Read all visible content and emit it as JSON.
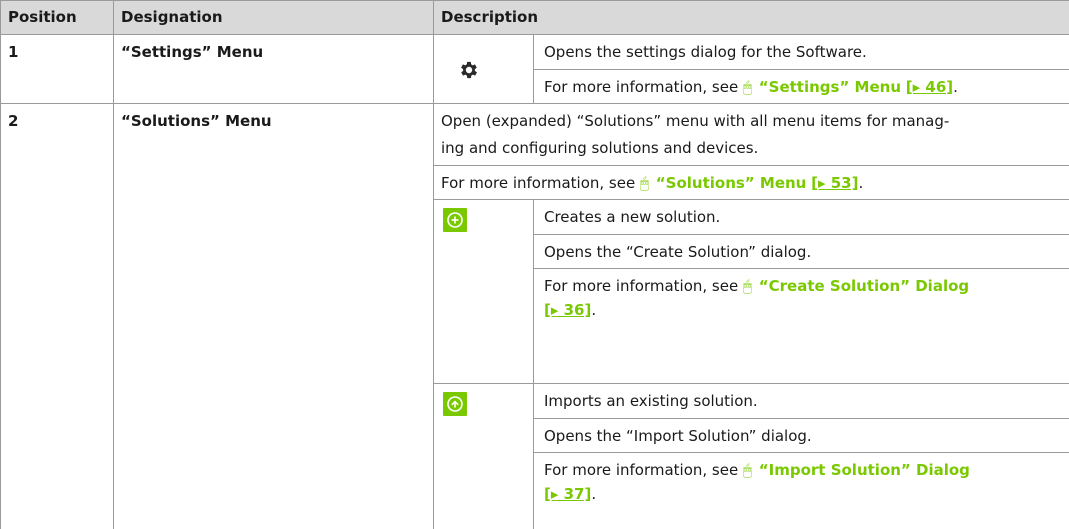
{
  "header": {
    "position": "Position",
    "designation": "Designation",
    "description": "Description"
  },
  "rows": [
    {
      "position": "1",
      "designation": "“Settings” Menu",
      "icon": "gear-icon",
      "text": "Opens the settings dialog for the Software.",
      "more_prefix": "For more information, see",
      "link": "“Settings” Menu",
      "link_ref": "[▸ 46]"
    },
    {
      "position": "2",
      "designation": "“Solutions” Menu",
      "text_line1": "Open (expanded) “Solutions” menu with all menu items for manag-",
      "text_line2": "ing and configuring solutions and devices.",
      "more_prefix": "For more information, see",
      "link": "“Solutions” Menu",
      "link_ref": "[▸ 53]",
      "subitems": [
        {
          "icon": "add-circle-icon",
          "line1": "Creates a new solution.",
          "line2": "Opens the “Create Solution” dialog.",
          "more_prefix": "For more information, see",
          "link": "“Create Solution” Dialog",
          "link_ref": "[▸ 36]"
        },
        {
          "icon": "upload-circle-icon",
          "line1": "Imports an existing solution.",
          "line2": "Opens the “Import Solution” dialog.",
          "more_prefix": "For more information, see",
          "link": "“Import Solution” Dialog",
          "link_ref": "[▸ 37]"
        }
      ]
    }
  ],
  "colors": {
    "accent": "#7ac900",
    "header_bg": "#d9d9d9",
    "grid": "#9a9a9a"
  }
}
